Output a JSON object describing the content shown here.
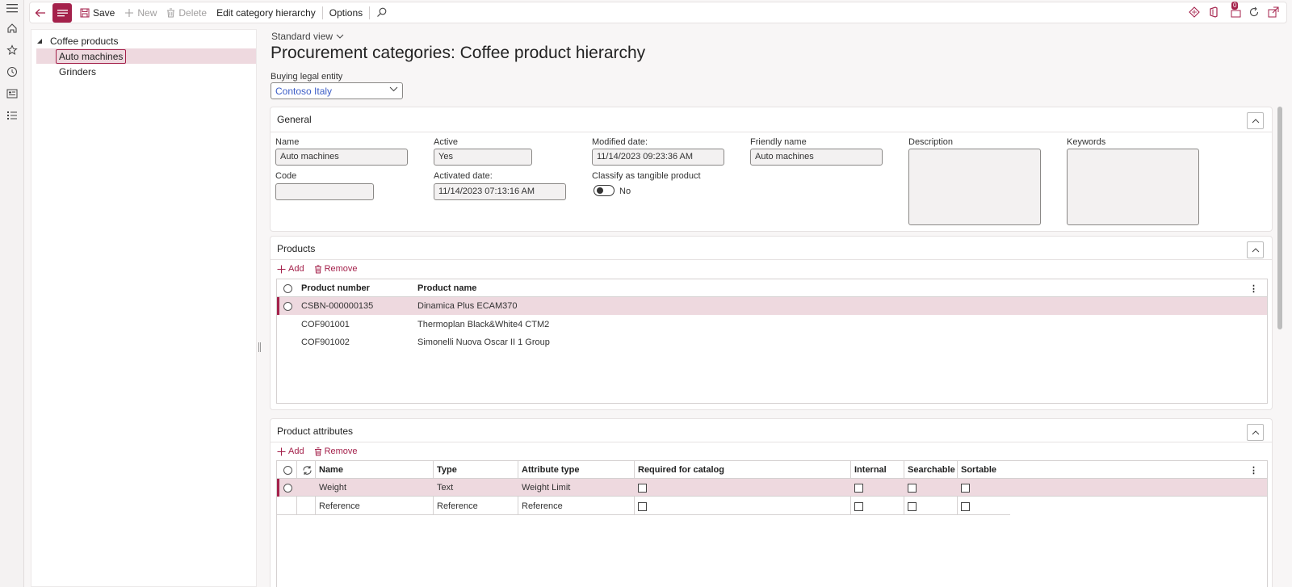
{
  "rail": {
    "icons": [
      "hamburger-icon",
      "home-icon",
      "star-icon",
      "clock-icon",
      "workspace-icon",
      "list-icon"
    ]
  },
  "actionbar": {
    "save_label": "Save",
    "new_label": "New",
    "delete_label": "Delete",
    "edit_hierarchy_label": "Edit category hierarchy",
    "options_label": "Options",
    "notification_count": "0"
  },
  "tree": {
    "root": "Coffee products",
    "items": [
      "Auto machines",
      "Grinders"
    ],
    "selected": "Auto machines"
  },
  "header": {
    "view": "Standard view",
    "title": "Procurement categories: Coffee product hierarchy"
  },
  "legal_entity": {
    "label": "Buying legal entity",
    "value": "Contoso Italy"
  },
  "general": {
    "title": "General",
    "name_label": "Name",
    "name_value": "Auto machines",
    "code_label": "Code",
    "code_value": "",
    "active_label": "Active",
    "active_value": "Yes",
    "activated_label": "Activated date:",
    "activated_value": "11/14/2023 07:13:16 AM",
    "modified_label": "Modified date:",
    "modified_value": "11/14/2023 09:23:36 AM",
    "tangible_label": "Classify as tangible product",
    "tangible_value": "No",
    "friendly_label": "Friendly name",
    "friendly_value": "Auto machines",
    "description_label": "Description",
    "keywords_label": "Keywords"
  },
  "products": {
    "title": "Products",
    "add_label": "Add",
    "remove_label": "Remove",
    "columns": [
      "Product number",
      "Product name"
    ],
    "rows": [
      {
        "number": "CSBN-000000135",
        "name": "Dinamica Plus ECAM370"
      },
      {
        "number": "COF901001",
        "name": "Thermoplan Black&White4 CTM2"
      },
      {
        "number": "COF901002",
        "name": "Simonelli Nuova Oscar II 1 Group"
      }
    ]
  },
  "attributes": {
    "title": "Product attributes",
    "add_label": "Add",
    "remove_label": "Remove",
    "columns": [
      "Name",
      "Type",
      "Attribute type",
      "Required for catalog",
      "Internal",
      "Searchable",
      "Sortable"
    ],
    "rows": [
      {
        "name": "Weight",
        "type": "Text",
        "attr_type": "Weight Limit"
      },
      {
        "name": "Reference",
        "type": "Reference",
        "attr_type": "Reference"
      }
    ]
  },
  "colors": {
    "accent": "#a4214b",
    "selected_row": "#eed9df"
  }
}
